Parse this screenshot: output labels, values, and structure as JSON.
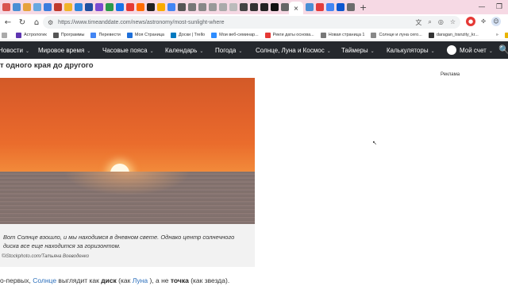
{
  "tabs": {
    "favicons": [
      "#d9534f",
      "#4a8fd4",
      "#e6a23c",
      "#67a8e0",
      "#3b7ddd",
      "#c0392b",
      "#f0b429",
      "#2e86de",
      "#1f4fa0",
      "#7b4ad1",
      "#2b9a4a",
      "#1a73e8",
      "#e53935",
      "#ff6d00",
      "#212121",
      "#f9ab00",
      "#4285f4",
      "#555",
      "#777",
      "#888",
      "#999",
      "#aaa",
      "#bbb",
      "#444",
      "#333",
      "#222",
      "#111",
      "#666",
      "#4a8fd4",
      "#e33b3b",
      "#4285f4",
      "#0b57d0",
      "#6c6c6c"
    ],
    "active_close": "×",
    "new_tab": "+",
    "minimize": "—",
    "maximize": "❐"
  },
  "toolbar": {
    "back": "←",
    "reload": "↻",
    "home": "⌂",
    "url": "https://www.timeanddate.com/news/astronomy/most-sunlight-where"
  },
  "bookmarks": [
    {
      "label": "Астрологик",
      "color": "#5e35b1"
    },
    {
      "label": "Программы",
      "color": "#555"
    },
    {
      "label": "Перевести",
      "color": "#4285f4"
    },
    {
      "label": "Моя Страница",
      "color": "#1e6fd9"
    },
    {
      "label": "Доски | Trello",
      "color": "#0079bf"
    },
    {
      "label": "Мои веб-семинар...",
      "color": "#2d8cff"
    },
    {
      "label": "Рекги даты основа...",
      "color": "#e53935"
    },
    {
      "label": "Новая страница 1",
      "color": "#777"
    },
    {
      "label": "Солнце и луна сего...",
      "color": "#888"
    },
    {
      "label": "daragan_tranzity_kr...",
      "color": "#333"
    }
  ],
  "bookmarks_more": "»",
  "bookmarks_all": "Все закл",
  "nav": {
    "items": [
      "Новости",
      "Мировое время",
      "Часовые пояса",
      "Календарь",
      "Погода",
      "Солнце, Луна и Космос",
      "Таймеры",
      "Калькуляторы",
      "Мой счет"
    ],
    "chevron": "⌄",
    "search": "🔍"
  },
  "article": {
    "headline": "т одного края до другого",
    "ad_label": "Реклама",
    "caption": "Вот Солнце взошло, и мы находимся в дневном свете. Однако центр солнечного диска все еще находится за горизонтом.",
    "credit": "©iStockphoto.com/Татьяна Воеводенко",
    "para_start": "о-первых, ",
    "para_sun": "Солнце",
    "para_mid1": " выглядит как ",
    "para_disk": "диск",
    "para_mid2": " (как ",
    "para_moon": "Луна",
    "para_mid3": " ), а не ",
    "para_point": "точка",
    "para_end": " (как звезда)."
  }
}
